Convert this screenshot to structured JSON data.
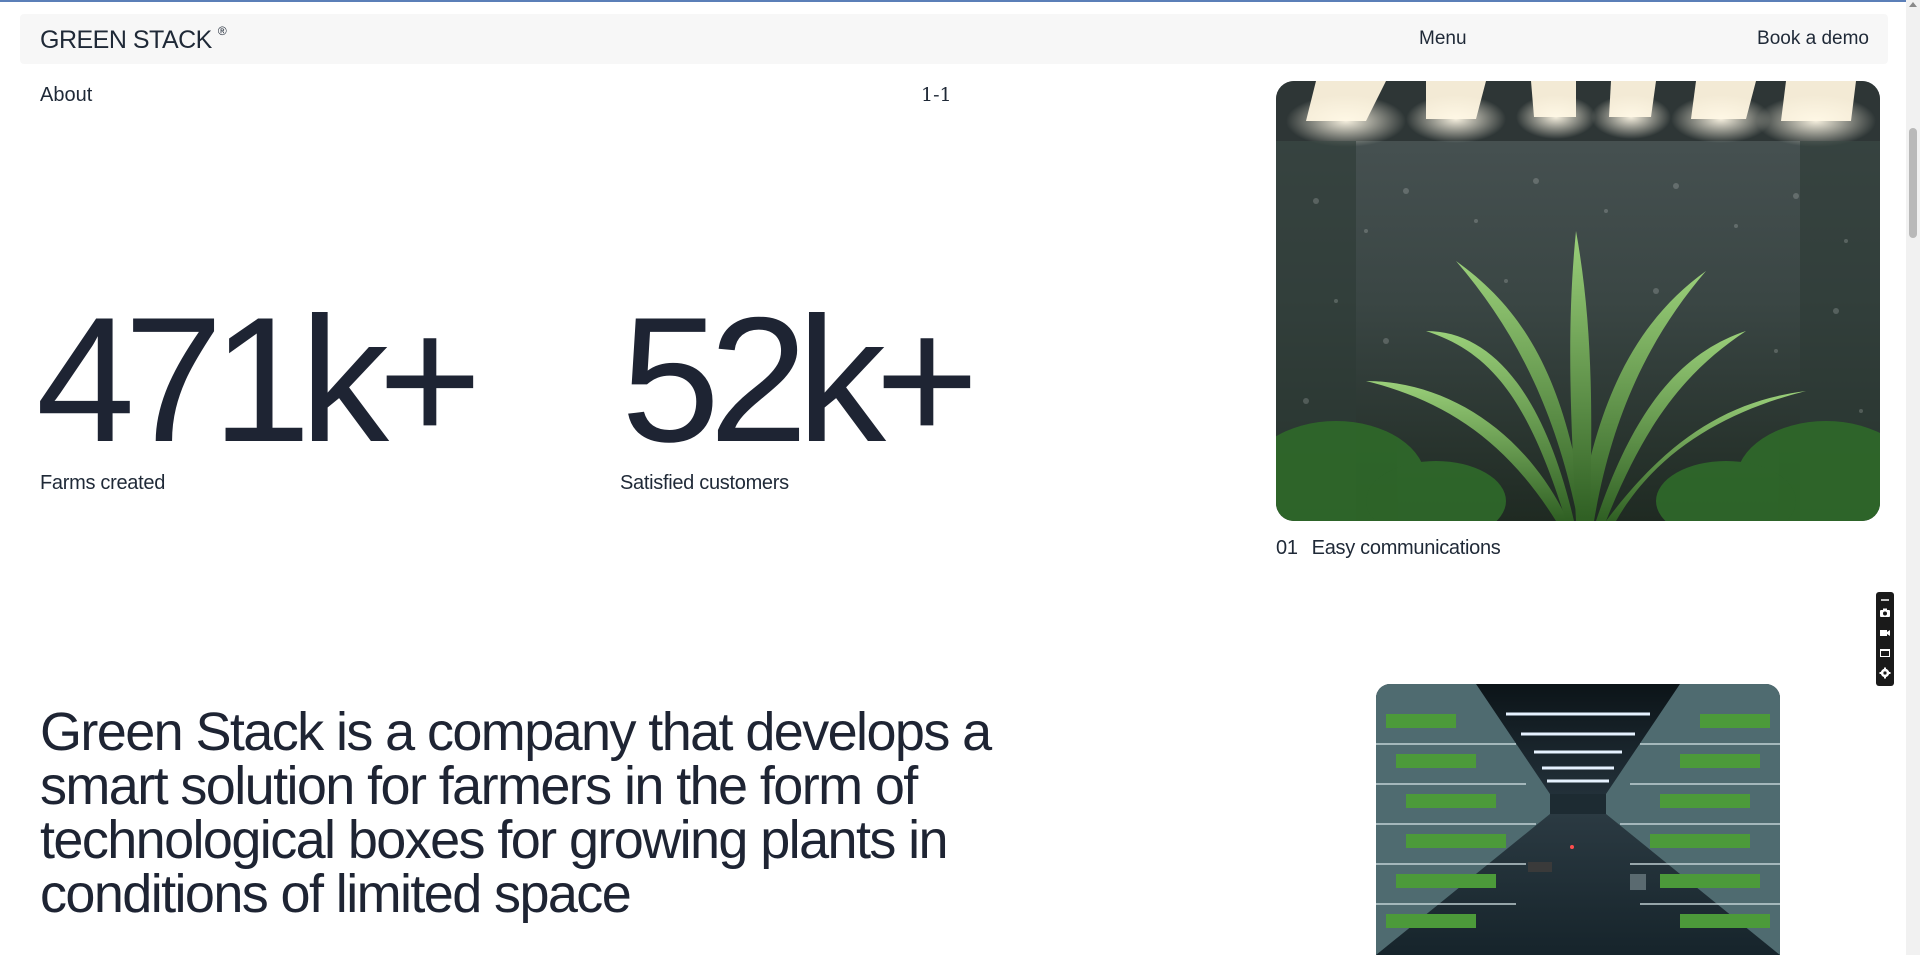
{
  "header": {
    "brand": "GREEN STACK",
    "brand_mark": "®",
    "menu_label": "Menu",
    "demo_label": "Book a demo"
  },
  "section": {
    "title": "About",
    "counter": "1-1"
  },
  "stats": [
    {
      "value": "471k+",
      "label": "Farms created"
    },
    {
      "value": "52k+",
      "label": "Satisfied customers"
    }
  ],
  "feature": {
    "number": "01",
    "title": "Easy communications"
  },
  "tagline": "Green Stack is a company that develops a smart solution for farmers in the form of technological boxes for growing plants in conditions of limited space",
  "colors": {
    "text": "#1e2433",
    "header_bg": "#f7f7f7",
    "plant_green": "#3f7a2f"
  },
  "icons": {
    "toolbar": [
      "camera-icon",
      "video-icon",
      "window-icon",
      "gear-icon"
    ]
  }
}
